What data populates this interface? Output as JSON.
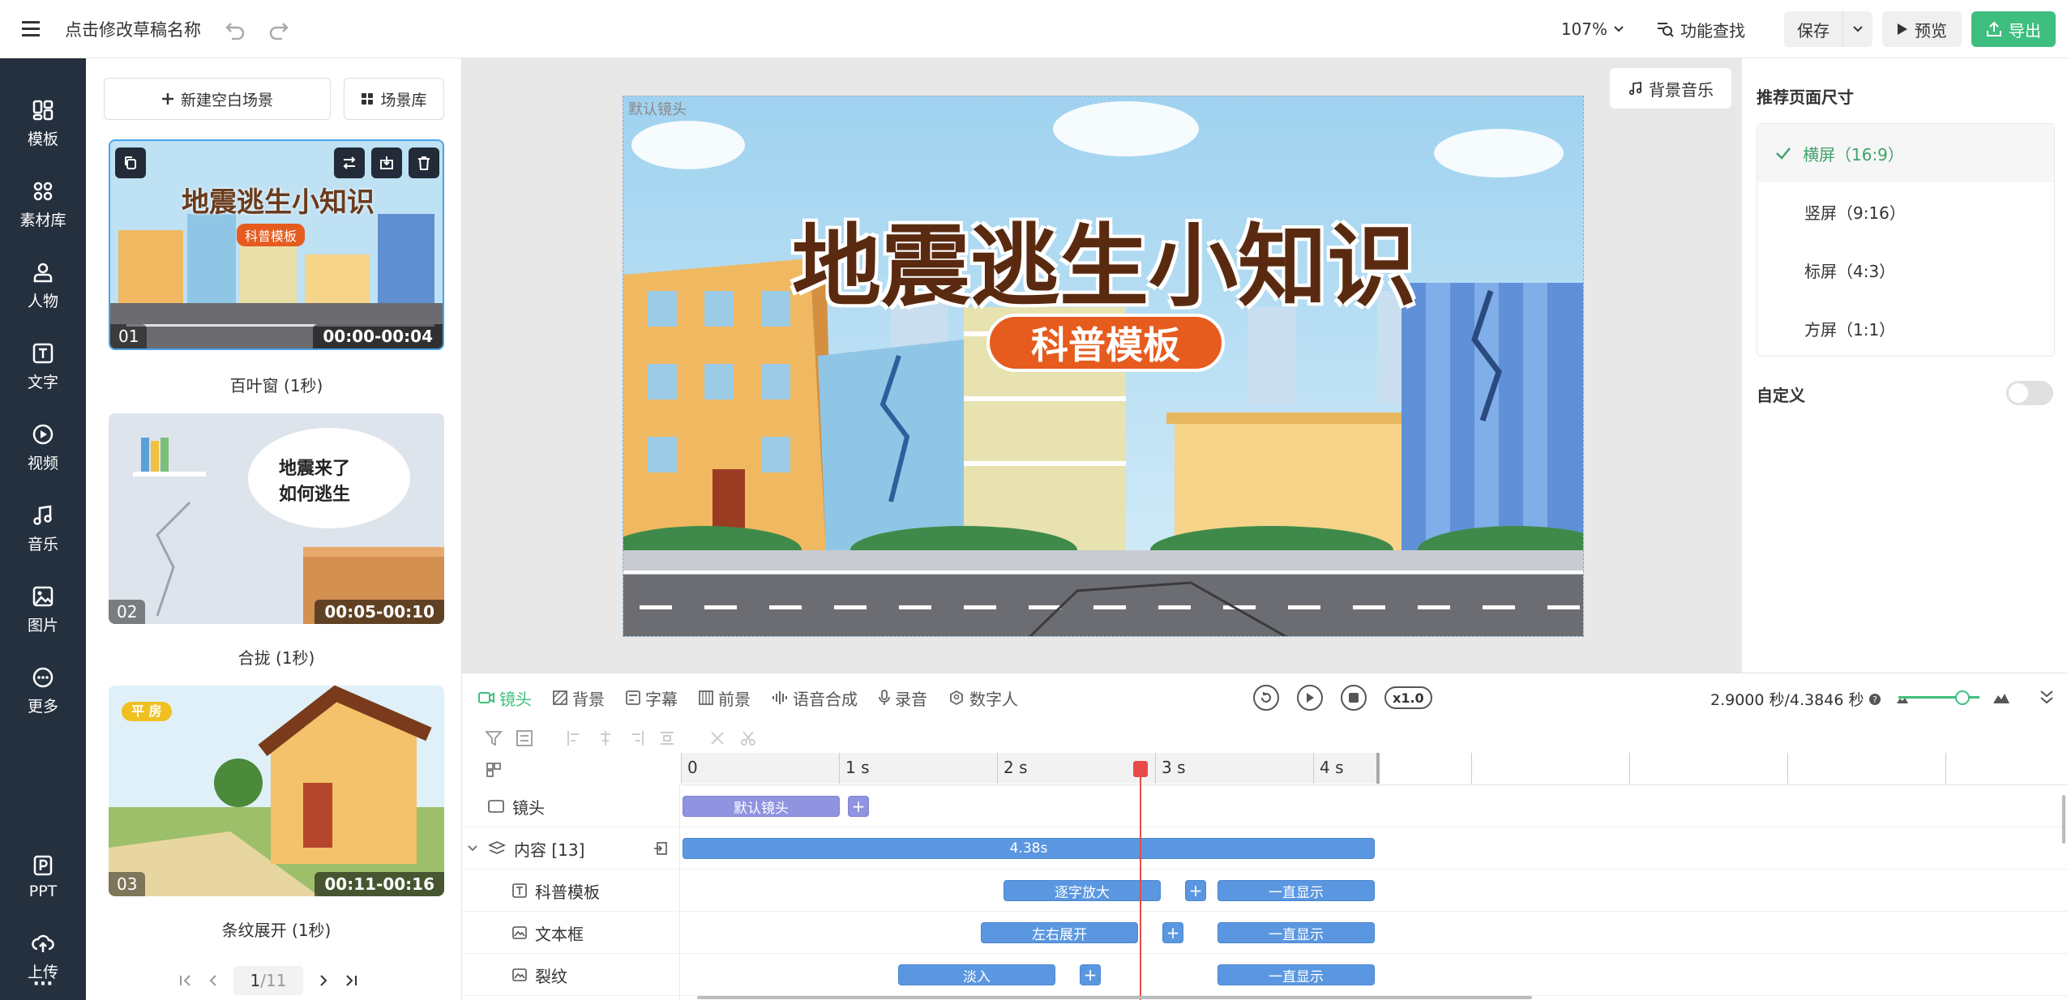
{
  "topbar": {
    "title": "点击修改草稿名称",
    "zoom": "107%",
    "feature_search": "功能查找",
    "save": "保存",
    "preview": "预览",
    "export": "导出"
  },
  "sidebar": {
    "items": [
      {
        "label": "模板",
        "icon": "template-icon"
      },
      {
        "label": "素材库",
        "icon": "materials-icon"
      },
      {
        "label": "人物",
        "icon": "person-icon"
      },
      {
        "label": "文字",
        "icon": "text-icon"
      },
      {
        "label": "视频",
        "icon": "video-icon"
      },
      {
        "label": "音乐",
        "icon": "music-icon"
      },
      {
        "label": "图片",
        "icon": "image-icon"
      },
      {
        "label": "更多",
        "icon": "more-icon"
      },
      {
        "label": "PPT",
        "icon": "ppt-icon"
      },
      {
        "label": "上传",
        "icon": "upload-icon"
      }
    ],
    "ellipsis": "···"
  },
  "scene_panel": {
    "new_scene": "新建空白场景",
    "scene_library": "场景库",
    "scenes": [
      {
        "index": "01",
        "range": "00:00-00:04",
        "label": "百叶窗 (1秒)",
        "title": "地震逃生小知识",
        "tag": "科普模板"
      },
      {
        "index": "02",
        "range": "00:05-00:10",
        "label": "合拢 (1秒)",
        "bubble_line1": "地震来了",
        "bubble_line2": "如何逃生"
      },
      {
        "index": "03",
        "range": "00:11-00:16",
        "label": "条纹展开 (1秒)",
        "tag": "平 房"
      }
    ],
    "pager": {
      "current": "1",
      "total": "/11"
    }
  },
  "canvas": {
    "bg_music": "背景音乐",
    "default_shot": "默认镜头",
    "headline": "地震逃生小知识",
    "badge": "科普模板"
  },
  "size_panel": {
    "heading": "推荐页面尺寸",
    "options": [
      "横屏（16:9）",
      "竖屏（9:16）",
      "标屏（4:3）",
      "方屏（1:1）"
    ],
    "selected_index": 0,
    "custom": "自定义",
    "custom_enabled": false
  },
  "timeline": {
    "tabs": [
      "镜头",
      "背景",
      "字幕",
      "前景",
      "语音合成",
      "录音",
      "数字人"
    ],
    "active_tab": 0,
    "speed": "x1.0",
    "time": "2.9000 秒/4.3846 秒",
    "ruler": [
      "0",
      "1 s",
      "2 s",
      "3 s",
      "4 s"
    ],
    "rows": [
      {
        "label": "镜头",
        "clip": "默认镜头"
      },
      {
        "label": "内容 [13]",
        "clip": "4.38s"
      },
      {
        "label": "科普模板",
        "clip": "逐字放大",
        "clip2": "一直显示"
      },
      {
        "label": "文本框",
        "clip": "左右展开",
        "clip2": "一直显示"
      },
      {
        "label": "裂纹",
        "clip": "淡入",
        "clip2": "一直显示"
      }
    ],
    "playhead_seconds": 2.9,
    "total_seconds": 4.3846
  },
  "colors": {
    "accent": "#3fbf7f",
    "sidebar": "#25303f",
    "clip_blue": "#5b97e0",
    "playhead": "#e84a4a"
  }
}
